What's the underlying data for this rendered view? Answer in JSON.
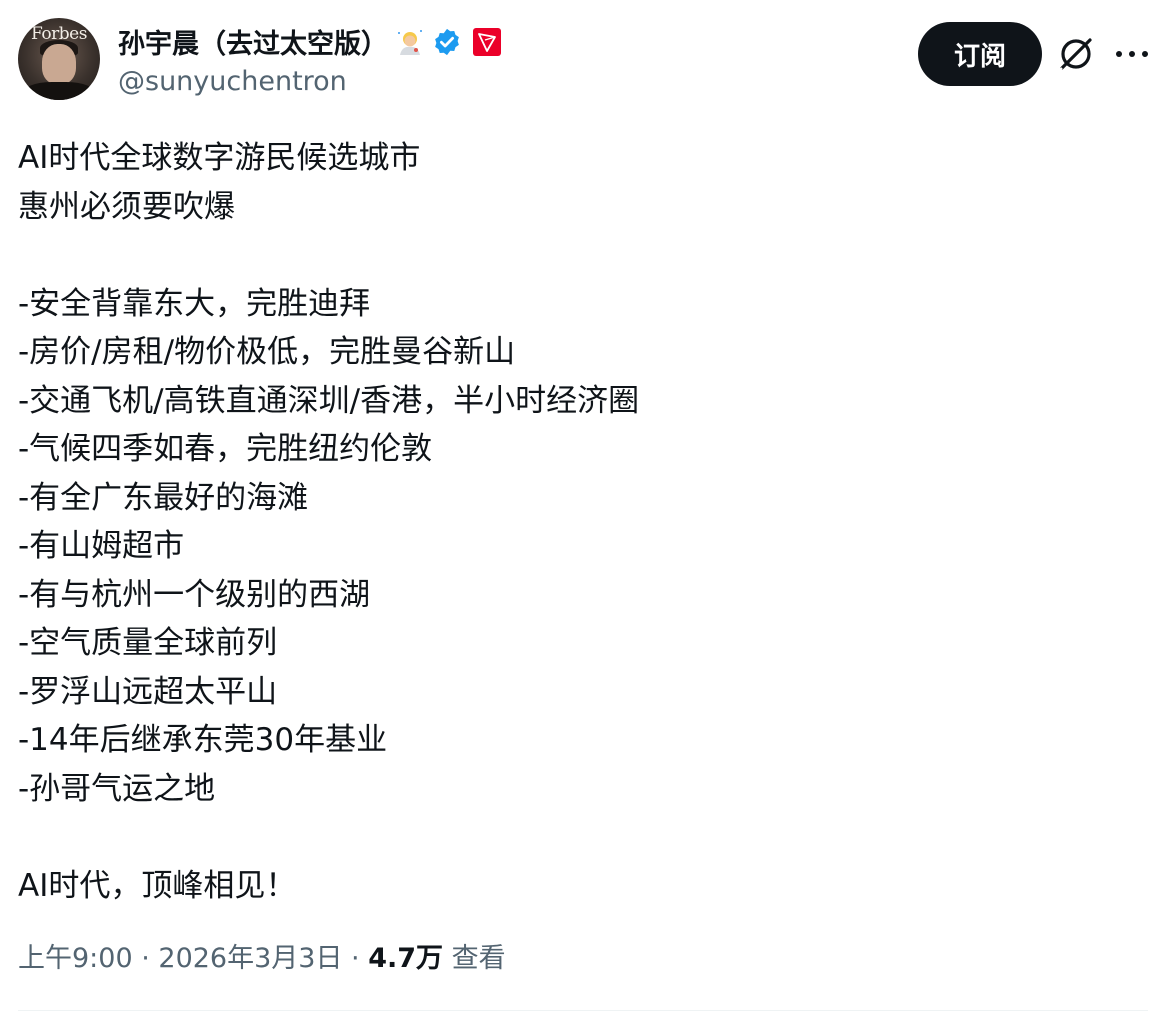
{
  "author": {
    "display_name": "孙宇晨（去过太空版）",
    "handle": "@sunyuchentron",
    "avatar_text": "Forbes",
    "verified": true,
    "badge_color": "#1d9bf0",
    "tron_color": "#eb0029"
  },
  "actions": {
    "subscribe_label": "订阅",
    "grok_icon": "grok-icon",
    "more_icon": "more-icon"
  },
  "tweet": {
    "lines": [
      "AI时代全球数字游民候选城市",
      "惠州必须要吹爆",
      "",
      "-安全背靠东大，完胜迪拜",
      "-房价/房租/物价极低，完胜曼谷新山",
      "-交通飞机/高铁直通深圳/香港，半小时经济圈",
      "-气候四季如春，完胜纽约伦敦",
      "-有全广东最好的海滩",
      "-有山姆超市",
      "-有与杭州一个级别的西湖",
      "-空气质量全球前列",
      "-罗浮山远超太平山",
      "-14年后继承东莞30年基业",
      "-孙哥气运之地",
      "",
      "AI时代，顶峰相见！"
    ]
  },
  "meta": {
    "time": "上午9:00",
    "date": "2026年3月3日",
    "separator": " · ",
    "views_count": "4.7万",
    "views_label": "查看"
  }
}
